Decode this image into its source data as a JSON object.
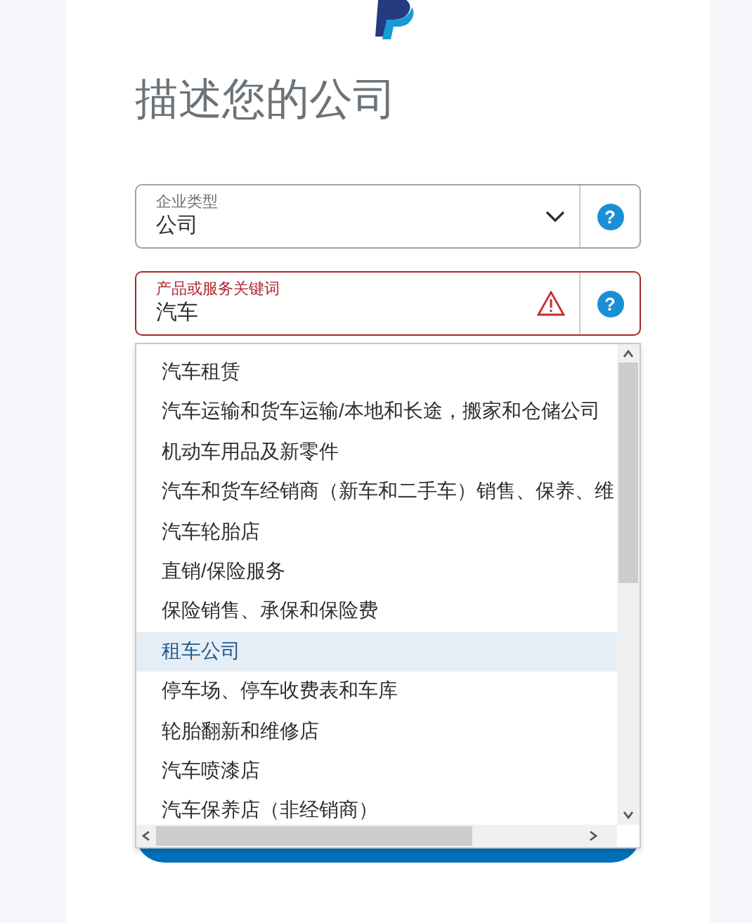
{
  "title": "描述您的公司",
  "fields": [
    {
      "kind": "select",
      "label": "企业类型",
      "value": "公司",
      "error": false,
      "help": "?"
    },
    {
      "kind": "text",
      "label": "产品或服务关键词",
      "value": "汽车",
      "error": true,
      "help": "?"
    }
  ],
  "dropdown": {
    "options": [
      {
        "label": "汽车租赁",
        "selected": false
      },
      {
        "label": "汽车运输和货车运输/本地和长途，搬家和仓储公司",
        "selected": false
      },
      {
        "label": "机动车用品及新零件",
        "selected": false
      },
      {
        "label": "汽车和货车经销商（新车和二手车）销售、保养、维",
        "selected": false
      },
      {
        "label": "汽车轮胎店",
        "selected": false
      },
      {
        "label": "直销/保险服务",
        "selected": false
      },
      {
        "label": "保险销售、承保和保险费",
        "selected": false
      },
      {
        "label": "租车公司",
        "selected": true
      },
      {
        "label": "停车场、停车收费表和车库",
        "selected": false
      },
      {
        "label": "轮胎翻新和维修店",
        "selected": false
      },
      {
        "label": "汽车喷漆店",
        "selected": false
      },
      {
        "label": "汽车保养店（非经销商）",
        "selected": false
      }
    ]
  }
}
